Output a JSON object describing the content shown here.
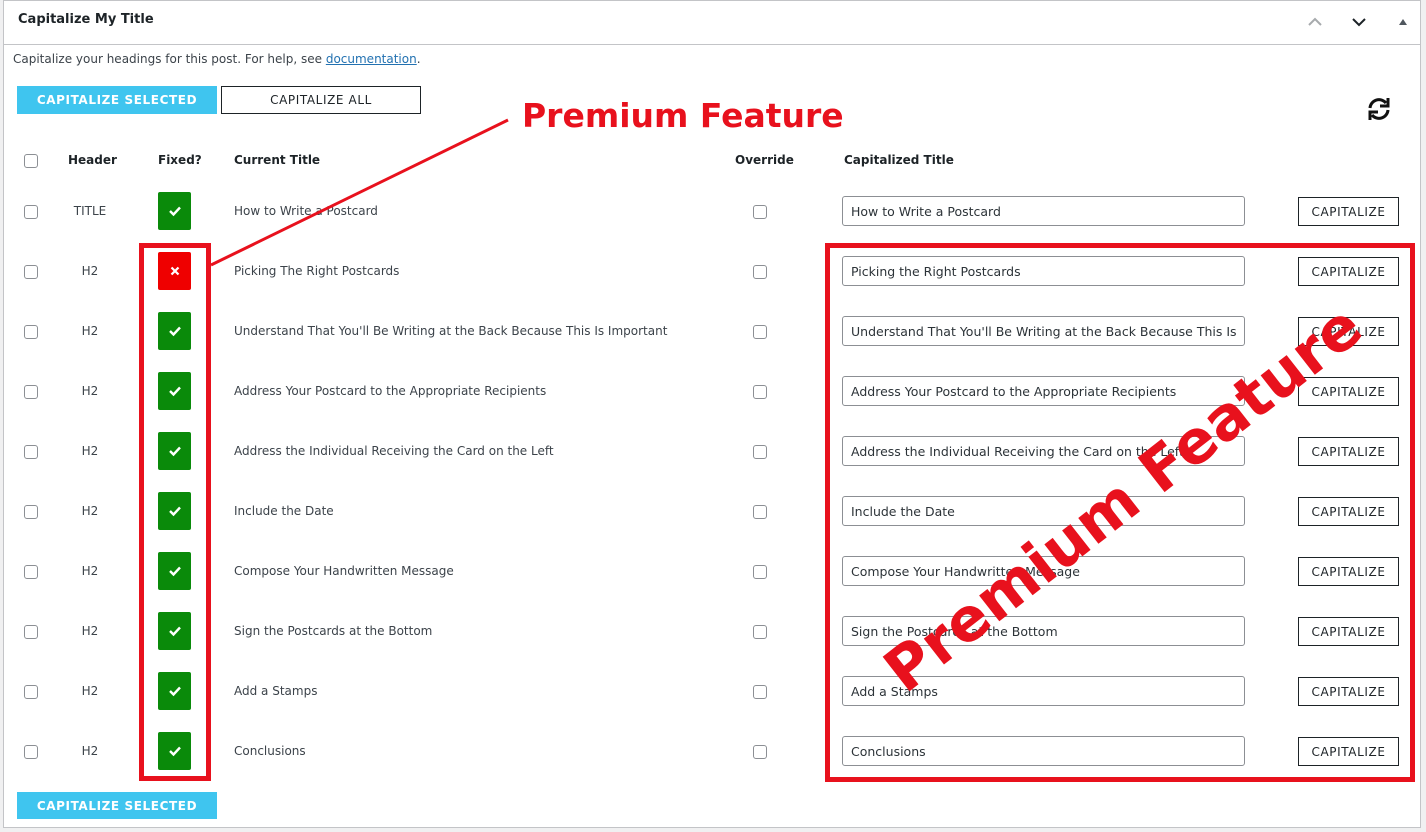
{
  "panel": {
    "title": "Capitalize My Title",
    "intro_text": "Capitalize your headings for this post. For help, see ",
    "intro_link": "documentation",
    "intro_end": "."
  },
  "toolbar": {
    "capitalize_selected": "CAPITALIZE SELECTED",
    "capitalize_all": "CAPITALIZE ALL",
    "capitalize_selected_bottom": "CAPITALIZE SELECTED"
  },
  "table": {
    "columns": {
      "header": "Header",
      "fixed": "Fixed?",
      "current_title": "Current Title",
      "override": "Override",
      "capitalized_title": "Capitalized Title"
    },
    "button_label": "CAPITALIZE",
    "rows": [
      {
        "header": "TITLE",
        "fixed": true,
        "current": "How to Write a Postcard",
        "capitalized": "How to Write a Postcard"
      },
      {
        "header": "H2",
        "fixed": false,
        "current": "Picking The Right Postcards",
        "capitalized": "Picking the Right Postcards"
      },
      {
        "header": "H2",
        "fixed": true,
        "current": "Understand That You'll Be Writing at the Back Because This Is Important",
        "capitalized": "Understand That You'll Be Writing at the Back Because This Is Important"
      },
      {
        "header": "H2",
        "fixed": true,
        "current": "Address Your Postcard to the Appropriate Recipients",
        "capitalized": "Address Your Postcard to the Appropriate Recipients"
      },
      {
        "header": "H2",
        "fixed": true,
        "current": "Address the Individual Receiving the Card on the Left",
        "capitalized": "Address the Individual Receiving the Card on the Left"
      },
      {
        "header": "H2",
        "fixed": true,
        "current": "Include the Date",
        "capitalized": "Include the Date"
      },
      {
        "header": "H2",
        "fixed": true,
        "current": "Compose Your Handwritten Message",
        "capitalized": "Compose Your Handwritten Message"
      },
      {
        "header": "H2",
        "fixed": true,
        "current": "Sign the Postcards at the Bottom",
        "capitalized": "Sign the Postcards at the Bottom"
      },
      {
        "header": "H2",
        "fixed": true,
        "current": "Add a Stamps",
        "capitalized": "Add a Stamps"
      },
      {
        "header": "H2",
        "fixed": true,
        "current": "Conclusions",
        "capitalized": "Conclusions"
      }
    ]
  },
  "annotations": {
    "label_top": "Premium Feature",
    "label_diagonal": "Premium Feature",
    "color": "#e8111d"
  }
}
